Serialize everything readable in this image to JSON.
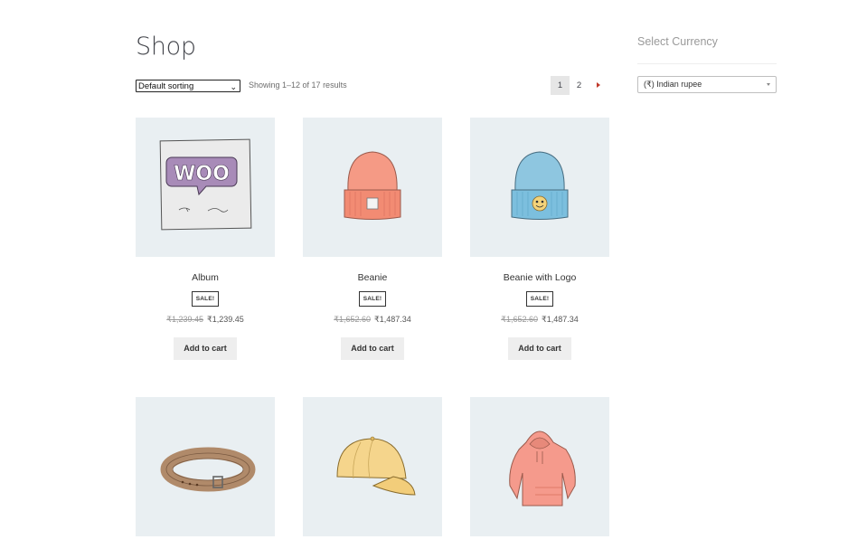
{
  "page": {
    "title": "Shop"
  },
  "toolbar": {
    "sort_label": "Default sorting",
    "result_count": "Showing 1–12 of 17 results",
    "pages": [
      "1",
      "2"
    ],
    "current_page": "1",
    "next_icon": "next-arrow"
  },
  "sidebar": {
    "title": "Select Currency",
    "currency_value": "(₹) Indian rupee"
  },
  "products": [
    {
      "name": "Album",
      "badge": "SALE!",
      "old_price": "₹1,239.45",
      "price": "₹1,239.45",
      "button": "Add to cart",
      "image": "album"
    },
    {
      "name": "Beanie",
      "badge": "SALE!",
      "old_price": "₹1,652.60",
      "price": "₹1,487.34",
      "button": "Add to cart",
      "image": "beanie"
    },
    {
      "name": "Beanie with Logo",
      "badge": "SALE!",
      "old_price": "₹1,652.60",
      "price": "₹1,487.34",
      "button": "Add to cart",
      "image": "beanie-with-logo"
    },
    {
      "image": "belt"
    },
    {
      "image": "cap"
    },
    {
      "image": "hoodie"
    }
  ],
  "colors": {
    "accent": "#c0392b",
    "thumb_bg": "#e9eff2",
    "button_bg": "#eeeeee"
  }
}
